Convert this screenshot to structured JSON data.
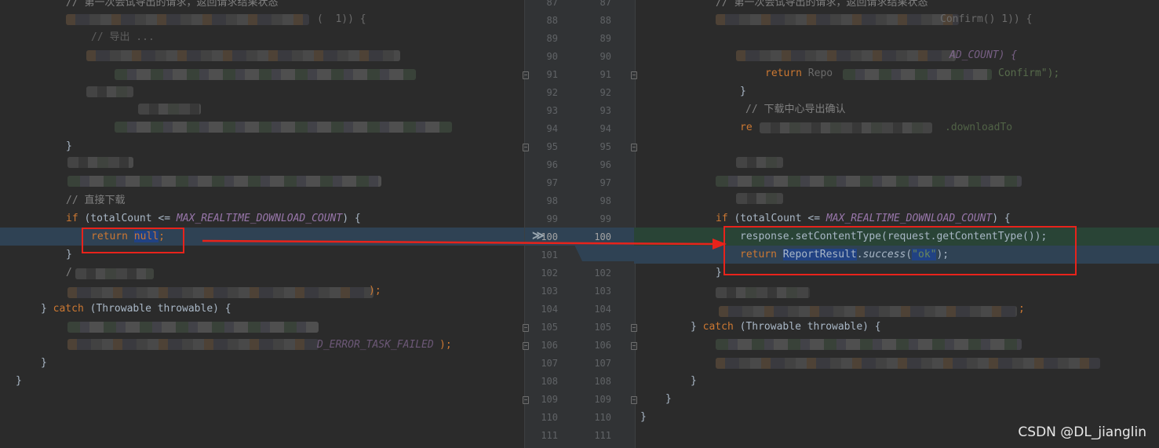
{
  "left": {
    "comment_export": "// 第一次会试导出的请求，返回请求结果状态",
    "comment_download": "// 直接下载",
    "if_kw": "if",
    "if_cond_open": " (totalCount <= ",
    "if_const": "MAX_REALTIME_DOWNLOAD_COUNT",
    "if_cond_close": ") {",
    "return_kw": "return",
    "return_val": "null",
    "semicolon": ";",
    "close_brace": "}",
    "catch_open": "} ",
    "catch_kw": "catch",
    "catch_rest": " (Throwable throwable) {",
    "frag_error": "D_ERROR_TASK_FAILED",
    "frag_paren": ");",
    "frag_comment_short": "// 导出 ...",
    "frag_slash": "/"
  },
  "right": {
    "comment_export": "// 第一次会试导出的请求，返回请求结果状态",
    "frag_confirm": "Confirm()",
    "frag_count": "AD_COUNT) {",
    "return_kw": "return",
    "frag_report": " Repo",
    "frag_confirm_str": "Confirm\");",
    "close_brace": "}",
    "comment_center": "// 下载中心导出确认",
    "frag_re": "re",
    "frag_download": ".downloadTo",
    "if_kw": "if",
    "if_cond_open": " (totalCount <= ",
    "if_const": "MAX_REALTIME_DOWNLOAD_COUNT",
    "if_cond_close": ") {",
    "line_set_type": "response.setContentType(request.getContentType());",
    "report_class": "ReportResult",
    "report_dot": ".",
    "report_method": "success",
    "paren_open": "(",
    "ok_str": "\"ok\"",
    "paren_close": ");",
    "catch_open": "} ",
    "catch_kw": "catch",
    "catch_rest": " (Throwable throwable) {",
    "semicolon": ";",
    "final_brace": "}"
  },
  "gutter": {
    "left_numbers": [
      "87",
      "88",
      "89",
      "90",
      "91",
      "92",
      "93",
      "94",
      "95",
      "96",
      "97",
      "98",
      "99",
      "100",
      "101",
      "102",
      "103",
      "104",
      "105",
      "106",
      "107",
      "108",
      "109",
      "110",
      "111"
    ],
    "right_numbers": [
      "87",
      "88",
      "89",
      "90",
      "91",
      "92",
      "93",
      "94",
      "95",
      "96",
      "97",
      "98",
      "99",
      "100",
      "101",
      "102",
      "103",
      "104",
      "105",
      "106",
      "107",
      "108",
      "109",
      "110",
      "111"
    ],
    "merge_arrow": "≫"
  },
  "colors": {
    "background": "#2b2b2b",
    "keyword": "#cc7832",
    "comment": "#808080",
    "constant": "#9876aa",
    "string": "#6a8759",
    "annotation_red": "#e8231b",
    "diff_modified": "#2f4254",
    "diff_added": "#294436"
  },
  "watermark": "CSDN @DL_jianglin"
}
